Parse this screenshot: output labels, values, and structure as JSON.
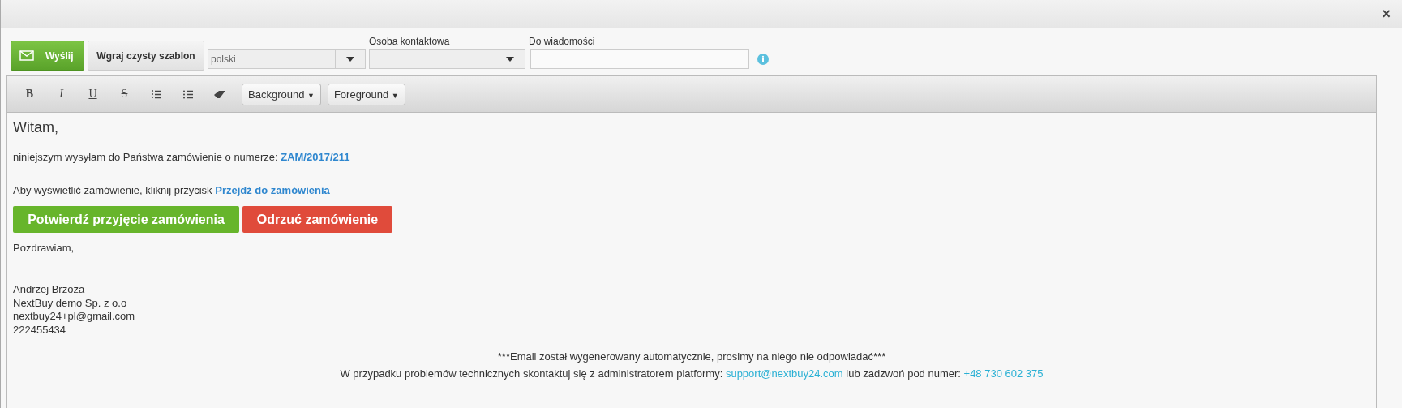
{
  "window": {
    "close": "×"
  },
  "toolbar": {
    "send_button": "Wyślij",
    "template_button": "Wgraj czysty szablon",
    "language": {
      "value": "polski"
    },
    "contact": {
      "label": "Osoba kontaktowa"
    },
    "cc": {
      "label": "Do wiadomości"
    }
  },
  "editor_toolbar": {
    "tools": [
      {
        "kind": "bold",
        "label": "B"
      },
      {
        "kind": "italic",
        "label": "I"
      },
      {
        "kind": "underline",
        "label": "U"
      },
      {
        "kind": "strike",
        "label": "S"
      },
      {
        "kind": "ordered-list"
      },
      {
        "kind": "bullet-list"
      },
      {
        "kind": "eraser"
      }
    ],
    "dropdowns": [
      {
        "label": "Background",
        "caret": "▼"
      },
      {
        "label": "Foreground",
        "caret": "▼"
      }
    ]
  },
  "body": {
    "greeting": "Witam,",
    "order_line": {
      "text": "niniejszym wysyłam do Państwa zamówienie o numerze:",
      "link": "ZAM/2017/211"
    },
    "view_line": {
      "text": "Aby wyświetlić zamówienie, kliknij przycisk",
      "link": "Przejdź do zamówienia"
    },
    "actions": [
      {
        "kind": "confirm",
        "label": "Potwierdź przyjęcie zamówienia"
      },
      {
        "kind": "reject",
        "label": "Odrzuć zamówienie"
      }
    ],
    "closing": "Pozdrawiam,",
    "signature": [
      "Andrzej Brzoza",
      "NextBuy demo Sp. z o.o",
      "nextbuy24+pl@gmail.com",
      "222455434"
    ],
    "footer_notice": "***Email został wygenerowany automatycznie, prosimy na niego nie odpowiadać***",
    "footer_contact": {
      "text": "W przypadku problemów technicznych skontaktuj się z administratorem platformy:",
      "email": "support@nextbuy24.com",
      "middle": "lub zadzwoń pod numer:",
      "phone": "+48 730 602 375"
    }
  }
}
